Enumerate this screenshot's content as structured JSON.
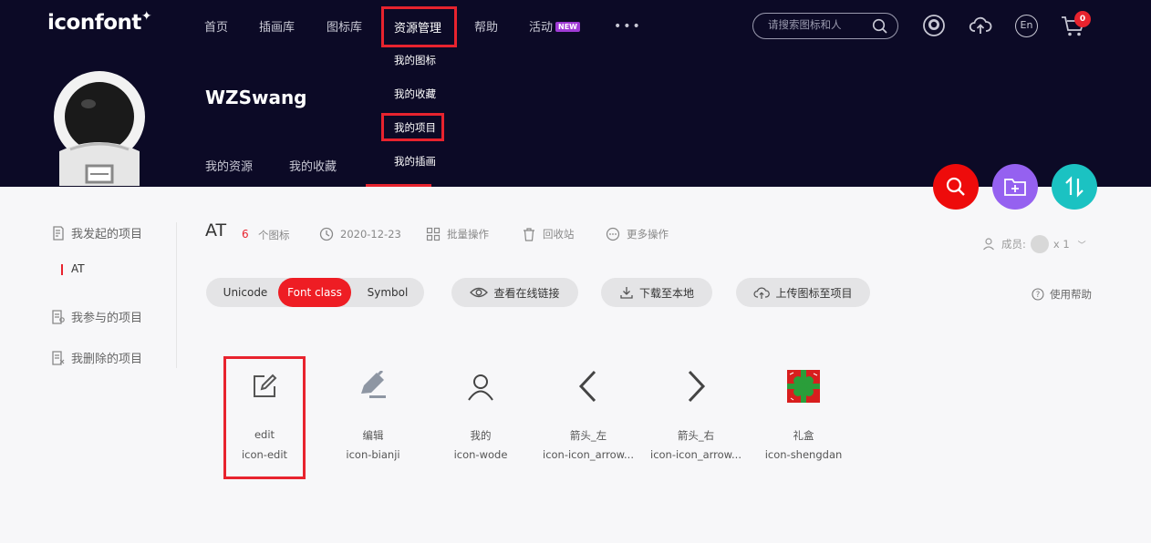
{
  "logo": "iconfont",
  "nav": [
    "首页",
    "插画库",
    "图标库",
    "资源管理",
    "帮助",
    "活动"
  ],
  "nav_new_badge": "NEW",
  "nav_more": "•••",
  "dropdown": [
    "我的图标",
    "我的收藏",
    "我的项目",
    "我的插画"
  ],
  "search": {
    "placeholder": "请搜索图标和人"
  },
  "header_icons": [
    "user-avatar-icon",
    "cloud-upload-icon",
    "language-en-icon",
    "cart-icon"
  ],
  "lang_label": "En",
  "cart_count": "0",
  "username": "WZSwang",
  "subtabs": [
    "我的资源",
    "我的收藏"
  ],
  "fab_colors": {
    "search": "#ee0b0b",
    "add_folder": "#9561f0",
    "sort": "#1bc2c2"
  },
  "sidebar": {
    "started": "我发起的项目",
    "active_project": "AT",
    "joined": "我参与的项目",
    "deleted": "我删除的项目"
  },
  "project": {
    "title": "AT",
    "count": "6",
    "count_label": "个图标",
    "date": "2020-12-23",
    "batch": "批量操作",
    "recycle": "回收站",
    "more": "更多操作",
    "members_label": "成员:",
    "members_count": "x 1"
  },
  "toolbar": {
    "seg": [
      "Unicode",
      "Font class",
      "Symbol"
    ],
    "active_seg": "Font class",
    "view_online": "查看在线链接",
    "download": "下载至本地",
    "upload": "上传图标至项目",
    "help": "使用帮助"
  },
  "icons": [
    {
      "name": "edit",
      "class": "icon-edit"
    },
    {
      "name": "编辑",
      "class": "icon-bianji"
    },
    {
      "name": "我的",
      "class": "icon-wode"
    },
    {
      "name": "箭头_左",
      "class": "icon-icon_arrow..."
    },
    {
      "name": "箭头_右",
      "class": "icon-icon_arrow..."
    },
    {
      "name": "礼盒",
      "class": "icon-shengdan"
    }
  ],
  "accent_color": "#e8232e"
}
